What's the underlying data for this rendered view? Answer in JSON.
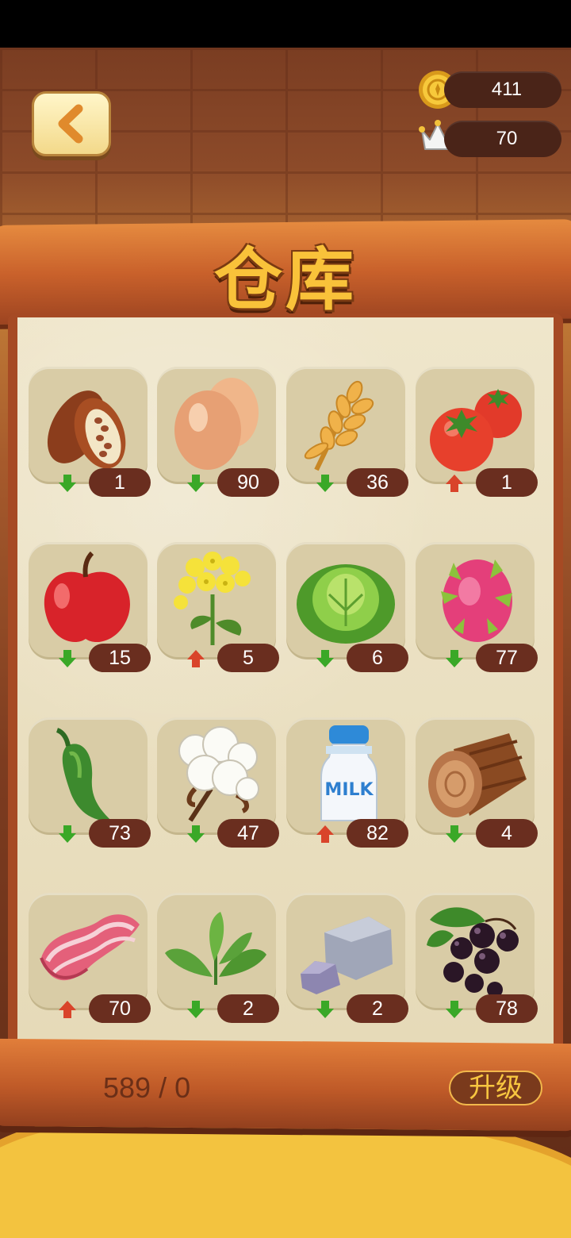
{
  "title": "仓库",
  "currencies": {
    "coins": "411",
    "crowns": "70"
  },
  "items": [
    {
      "name": "cacao",
      "count": "1",
      "trend": "down"
    },
    {
      "name": "egg",
      "count": "90",
      "trend": "down"
    },
    {
      "name": "wheat",
      "count": "36",
      "trend": "down"
    },
    {
      "name": "tomato",
      "count": "1",
      "trend": "up"
    },
    {
      "name": "apple",
      "count": "15",
      "trend": "down"
    },
    {
      "name": "rapeseed-flower",
      "count": "5",
      "trend": "up"
    },
    {
      "name": "cabbage",
      "count": "6",
      "trend": "down"
    },
    {
      "name": "dragon-fruit",
      "count": "77",
      "trend": "down"
    },
    {
      "name": "green-pepper",
      "count": "73",
      "trend": "down"
    },
    {
      "name": "cotton",
      "count": "47",
      "trend": "down"
    },
    {
      "name": "milk",
      "count": "82",
      "trend": "up"
    },
    {
      "name": "wood-log",
      "count": "4",
      "trend": "down"
    },
    {
      "name": "bacon",
      "count": "70",
      "trend": "up"
    },
    {
      "name": "herb-leaves",
      "count": "2",
      "trend": "down"
    },
    {
      "name": "stone",
      "count": "2",
      "trend": "down"
    },
    {
      "name": "blackcurrant",
      "count": "78",
      "trend": "down"
    }
  ],
  "milk_label": "MILK",
  "capacity": "589 / 0",
  "upgrade_label": "升级",
  "colors": {
    "trend_up": "#d9442a",
    "trend_down": "#3aa827",
    "count_pill": "#6a2e1f",
    "title": "#f9c23a"
  }
}
